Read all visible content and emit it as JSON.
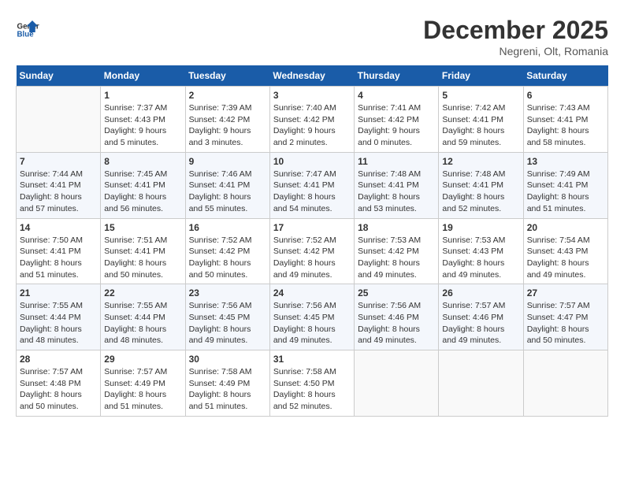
{
  "logo": {
    "line1": "General",
    "line2": "Blue"
  },
  "title": "December 2025",
  "location": "Negreni, Olt, Romania",
  "weekdays": [
    "Sunday",
    "Monday",
    "Tuesday",
    "Wednesday",
    "Thursday",
    "Friday",
    "Saturday"
  ],
  "weeks": [
    [
      {
        "day": "",
        "info": ""
      },
      {
        "day": "1",
        "info": "Sunrise: 7:37 AM\nSunset: 4:43 PM\nDaylight: 9 hours\nand 5 minutes."
      },
      {
        "day": "2",
        "info": "Sunrise: 7:39 AM\nSunset: 4:42 PM\nDaylight: 9 hours\nand 3 minutes."
      },
      {
        "day": "3",
        "info": "Sunrise: 7:40 AM\nSunset: 4:42 PM\nDaylight: 9 hours\nand 2 minutes."
      },
      {
        "day": "4",
        "info": "Sunrise: 7:41 AM\nSunset: 4:42 PM\nDaylight: 9 hours\nand 0 minutes."
      },
      {
        "day": "5",
        "info": "Sunrise: 7:42 AM\nSunset: 4:41 PM\nDaylight: 8 hours\nand 59 minutes."
      },
      {
        "day": "6",
        "info": "Sunrise: 7:43 AM\nSunset: 4:41 PM\nDaylight: 8 hours\nand 58 minutes."
      }
    ],
    [
      {
        "day": "7",
        "info": "Sunrise: 7:44 AM\nSunset: 4:41 PM\nDaylight: 8 hours\nand 57 minutes."
      },
      {
        "day": "8",
        "info": "Sunrise: 7:45 AM\nSunset: 4:41 PM\nDaylight: 8 hours\nand 56 minutes."
      },
      {
        "day": "9",
        "info": "Sunrise: 7:46 AM\nSunset: 4:41 PM\nDaylight: 8 hours\nand 55 minutes."
      },
      {
        "day": "10",
        "info": "Sunrise: 7:47 AM\nSunset: 4:41 PM\nDaylight: 8 hours\nand 54 minutes."
      },
      {
        "day": "11",
        "info": "Sunrise: 7:48 AM\nSunset: 4:41 PM\nDaylight: 8 hours\nand 53 minutes."
      },
      {
        "day": "12",
        "info": "Sunrise: 7:48 AM\nSunset: 4:41 PM\nDaylight: 8 hours\nand 52 minutes."
      },
      {
        "day": "13",
        "info": "Sunrise: 7:49 AM\nSunset: 4:41 PM\nDaylight: 8 hours\nand 51 minutes."
      }
    ],
    [
      {
        "day": "14",
        "info": "Sunrise: 7:50 AM\nSunset: 4:41 PM\nDaylight: 8 hours\nand 51 minutes."
      },
      {
        "day": "15",
        "info": "Sunrise: 7:51 AM\nSunset: 4:41 PM\nDaylight: 8 hours\nand 50 minutes."
      },
      {
        "day": "16",
        "info": "Sunrise: 7:52 AM\nSunset: 4:42 PM\nDaylight: 8 hours\nand 50 minutes."
      },
      {
        "day": "17",
        "info": "Sunrise: 7:52 AM\nSunset: 4:42 PM\nDaylight: 8 hours\nand 49 minutes."
      },
      {
        "day": "18",
        "info": "Sunrise: 7:53 AM\nSunset: 4:42 PM\nDaylight: 8 hours\nand 49 minutes."
      },
      {
        "day": "19",
        "info": "Sunrise: 7:53 AM\nSunset: 4:43 PM\nDaylight: 8 hours\nand 49 minutes."
      },
      {
        "day": "20",
        "info": "Sunrise: 7:54 AM\nSunset: 4:43 PM\nDaylight: 8 hours\nand 49 minutes."
      }
    ],
    [
      {
        "day": "21",
        "info": "Sunrise: 7:55 AM\nSunset: 4:44 PM\nDaylight: 8 hours\nand 48 minutes."
      },
      {
        "day": "22",
        "info": "Sunrise: 7:55 AM\nSunset: 4:44 PM\nDaylight: 8 hours\nand 48 minutes."
      },
      {
        "day": "23",
        "info": "Sunrise: 7:56 AM\nSunset: 4:45 PM\nDaylight: 8 hours\nand 49 minutes."
      },
      {
        "day": "24",
        "info": "Sunrise: 7:56 AM\nSunset: 4:45 PM\nDaylight: 8 hours\nand 49 minutes."
      },
      {
        "day": "25",
        "info": "Sunrise: 7:56 AM\nSunset: 4:46 PM\nDaylight: 8 hours\nand 49 minutes."
      },
      {
        "day": "26",
        "info": "Sunrise: 7:57 AM\nSunset: 4:46 PM\nDaylight: 8 hours\nand 49 minutes."
      },
      {
        "day": "27",
        "info": "Sunrise: 7:57 AM\nSunset: 4:47 PM\nDaylight: 8 hours\nand 50 minutes."
      }
    ],
    [
      {
        "day": "28",
        "info": "Sunrise: 7:57 AM\nSunset: 4:48 PM\nDaylight: 8 hours\nand 50 minutes."
      },
      {
        "day": "29",
        "info": "Sunrise: 7:57 AM\nSunset: 4:49 PM\nDaylight: 8 hours\nand 51 minutes."
      },
      {
        "day": "30",
        "info": "Sunrise: 7:58 AM\nSunset: 4:49 PM\nDaylight: 8 hours\nand 51 minutes."
      },
      {
        "day": "31",
        "info": "Sunrise: 7:58 AM\nSunset: 4:50 PM\nDaylight: 8 hours\nand 52 minutes."
      },
      {
        "day": "",
        "info": ""
      },
      {
        "day": "",
        "info": ""
      },
      {
        "day": "",
        "info": ""
      }
    ]
  ]
}
